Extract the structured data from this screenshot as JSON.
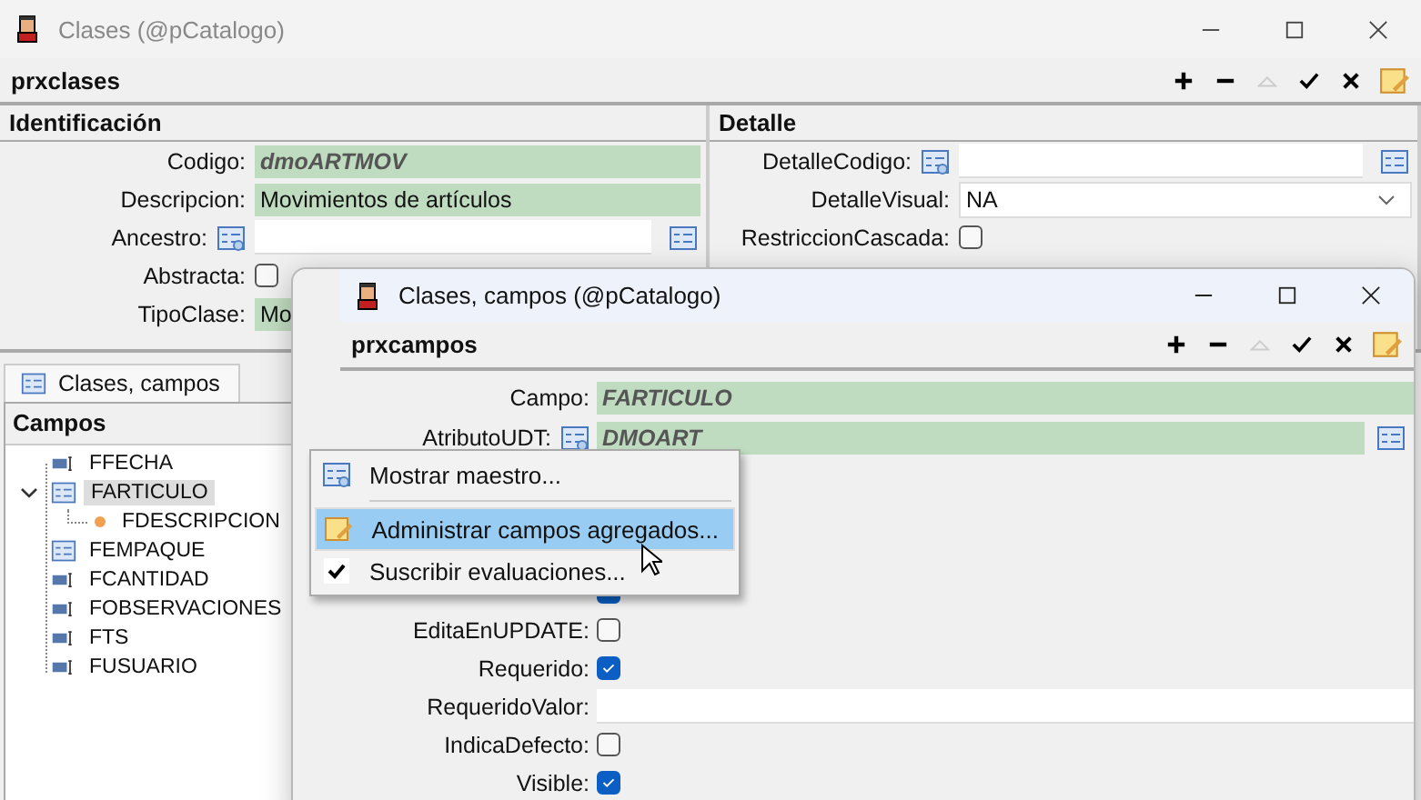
{
  "main_window": {
    "title": "Clases (@pCatalogo)",
    "toolbar_title": "prxclases",
    "identificacion": {
      "heading": "Identificación",
      "rows": [
        {
          "kind": "text",
          "label": "Codigo:",
          "value": "dmoARTMOV",
          "readonly": true,
          "key": true
        },
        {
          "kind": "text",
          "label": "Descripcion:",
          "value": "Movimientos de artículos",
          "readonly": true,
          "key": false
        },
        {
          "kind": "lookup",
          "label": "Ancestro:",
          "readonly": false
        },
        {
          "kind": "check",
          "label": "Abstracta:",
          "checked": false
        },
        {
          "kind": "text",
          "label": "TipoClase:",
          "value": "Mo",
          "readonly": true,
          "key": false
        }
      ]
    },
    "detalle": {
      "heading": "Detalle",
      "rows": [
        {
          "kind": "lookup",
          "label": "DetalleCodigo:",
          "readonly": false
        },
        {
          "kind": "select",
          "label": "DetalleVisual:",
          "value": "NA"
        },
        {
          "kind": "check",
          "label": "RestriccionCascada:",
          "checked": false
        }
      ]
    },
    "tabs": [
      {
        "label": "Clases, campos",
        "selected": true
      }
    ],
    "tree": {
      "heading": "Campos",
      "items": [
        {
          "label": "FFECHA",
          "kind": "field",
          "selected": false
        },
        {
          "label": "FARTICULO",
          "kind": "table",
          "selected": true,
          "expanded": true,
          "children": [
            {
              "label": "FDESCRIPCION",
              "kind": "attribute",
              "selected": false
            }
          ]
        },
        {
          "label": "FEMPAQUE",
          "kind": "table",
          "selected": false
        },
        {
          "label": "FCANTIDAD",
          "kind": "field",
          "selected": false
        },
        {
          "label": "FOBSERVACIONES",
          "kind": "field",
          "selected": false
        },
        {
          "label": "FTS",
          "kind": "field",
          "selected": false
        },
        {
          "label": "FUSUARIO",
          "kind": "field",
          "selected": false
        }
      ]
    }
  },
  "child_window": {
    "title": "Clases, campos (@pCatalogo)",
    "toolbar_title": "prxcampos",
    "rows": [
      {
        "kind": "text",
        "label": "Campo:",
        "value": "FARTICULO",
        "readonly": true,
        "key": true
      },
      {
        "kind": "lookup",
        "label": "AtributoUDT:",
        "value": "DMOART",
        "readonly": true,
        "key": true
      },
      {
        "kind": "hidden"
      },
      {
        "kind": "hidden"
      },
      {
        "kind": "hidden"
      },
      {
        "kind": "check",
        "checked": true
      },
      {
        "kind": "check",
        "label": "EditaEnUPDATE:",
        "checked": false
      },
      {
        "kind": "check",
        "label": "Requerido:",
        "checked": true
      },
      {
        "kind": "text",
        "label": "RequeridoValor:",
        "readonly": false
      },
      {
        "kind": "check",
        "label": "IndicaDefecto:",
        "checked": false
      },
      {
        "kind": "check",
        "label": "Visible:",
        "checked": true
      }
    ]
  },
  "context_menu": {
    "items": [
      {
        "kind": "lookup",
        "label": "Mostrar maestro...",
        "selected": false
      },
      {
        "kind": "separator"
      },
      {
        "kind": "edit",
        "label": "Administrar campos agregados...",
        "selected": true
      },
      {
        "kind": "check",
        "label": "Suscribir evaluaciones...",
        "selected": false,
        "checked": true
      }
    ]
  }
}
